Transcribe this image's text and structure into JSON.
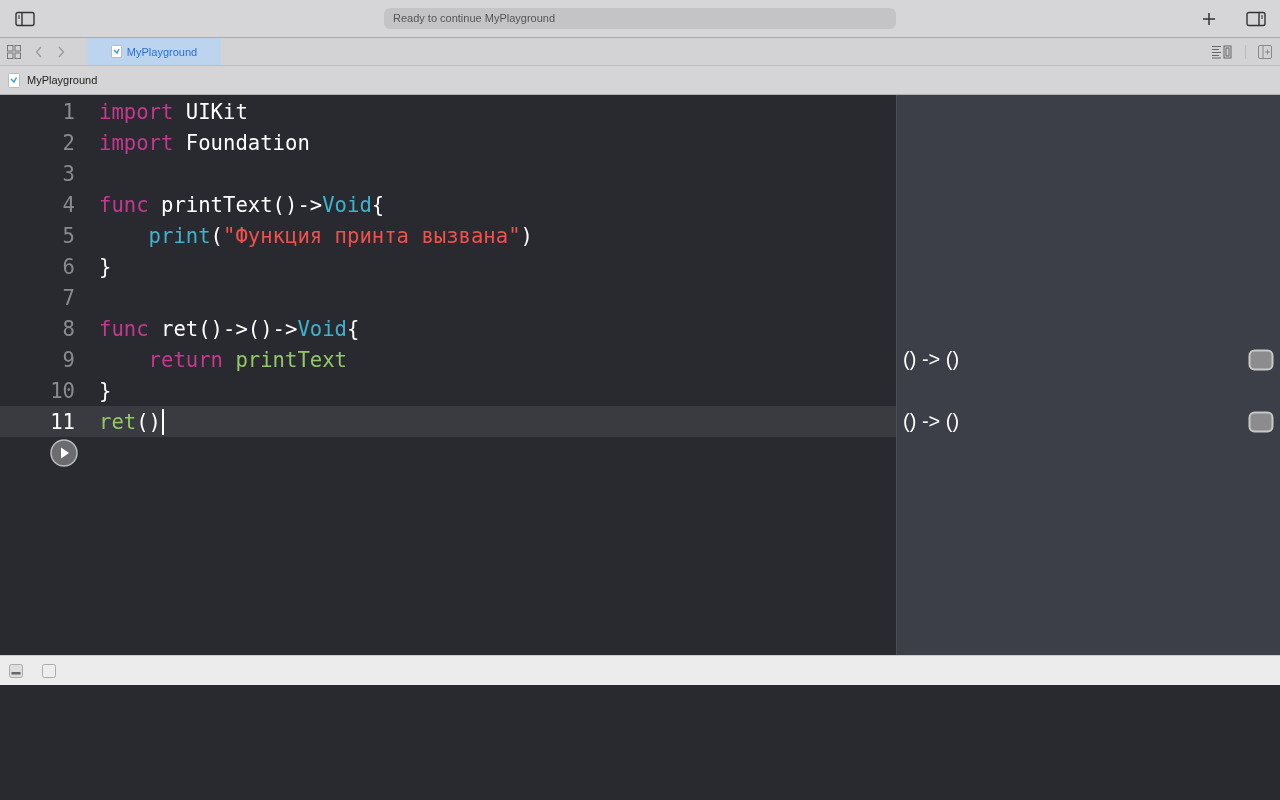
{
  "toolbar": {
    "status": "Ready to continue MyPlayground"
  },
  "tabs": [
    {
      "label": "MyPlayground",
      "selected": true
    }
  ],
  "jump_bar": {
    "file": "MyPlayground"
  },
  "editor": {
    "lines": [
      {
        "number": "1",
        "current": false,
        "tokens": [
          {
            "kind": "keyword",
            "text": "import"
          },
          {
            "kind": "plain",
            "text": " UIKit"
          }
        ]
      },
      {
        "number": "2",
        "current": false,
        "tokens": [
          {
            "kind": "keyword",
            "text": "import"
          },
          {
            "kind": "plain",
            "text": " Foundation"
          }
        ]
      },
      {
        "number": "3",
        "current": false
      },
      {
        "number": "4",
        "current": false,
        "tokens": [
          {
            "kind": "keyword",
            "text": "func"
          },
          {
            "kind": "plain",
            "text": " printText()->"
          },
          {
            "kind": "type",
            "text": "Void"
          },
          {
            "kind": "plain",
            "text": "{"
          }
        ]
      },
      {
        "number": "5",
        "current": false,
        "tokens": [
          {
            "kind": "type",
            "text": "    print"
          },
          {
            "kind": "plain",
            "text": "("
          },
          {
            "kind": "string",
            "text": "\"Функция принта вызвана\""
          },
          {
            "kind": "plain",
            "text": ")"
          }
        ]
      },
      {
        "number": "6",
        "current": false,
        "tokens": [
          {
            "kind": "plain",
            "text": "}"
          }
        ]
      },
      {
        "number": "7",
        "current": false
      },
      {
        "number": "8",
        "current": false,
        "tokens": [
          {
            "kind": "keyword",
            "text": "func"
          },
          {
            "kind": "plain",
            "text": " ret()->()->"
          },
          {
            "kind": "type",
            "text": "Void"
          },
          {
            "kind": "plain",
            "text": "{"
          }
        ]
      },
      {
        "number": "9",
        "current": false,
        "tokens": [
          {
            "kind": "keyword",
            "text": "    return "
          },
          {
            "kind": "call",
            "text": "printText"
          }
        ],
        "result": "() -> ()"
      },
      {
        "number": "10",
        "current": false,
        "tokens": [
          {
            "kind": "plain",
            "text": "}"
          }
        ]
      },
      {
        "number": "11",
        "current": true,
        "tokens": [
          {
            "kind": "call",
            "text": "ret"
          },
          {
            "kind": "plain",
            "text": "()"
          }
        ],
        "result": "() -> ()"
      }
    ]
  }
}
